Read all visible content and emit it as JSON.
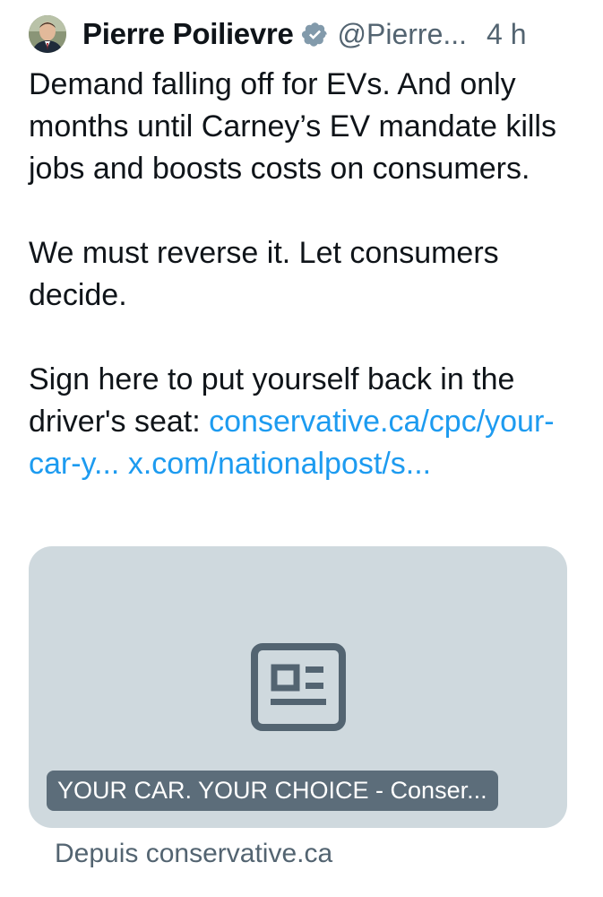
{
  "header": {
    "display_name": "Pierre Poilievre",
    "handle": "@Pierre...",
    "time": "4 h",
    "avatar_icon": "profile-photo",
    "verified_icon": "verified-badge-icon"
  },
  "tweet": {
    "paragraph_1": "Demand falling off for EVs. And only months until Carney’s EV mandate kills jobs and boosts costs on consumers.",
    "paragraph_2": "We must reverse it. Let consumers decide.",
    "paragraph_3_text": "Sign here to put yourself back in the driver's seat:",
    "link_1": "conservative.ca/cpc/your-car-y...",
    "link_2": "x.com/nationalpost/s..."
  },
  "card": {
    "icon": "article-icon",
    "title": "YOUR CAR. YOUR CHOICE - Conser...",
    "background_color": "#cfd9de"
  },
  "source": {
    "label": "Depuis conservative.ca"
  },
  "colors": {
    "link": "#1d9bf0",
    "secondary_text": "#536471",
    "verified_badge": "#829aab"
  }
}
